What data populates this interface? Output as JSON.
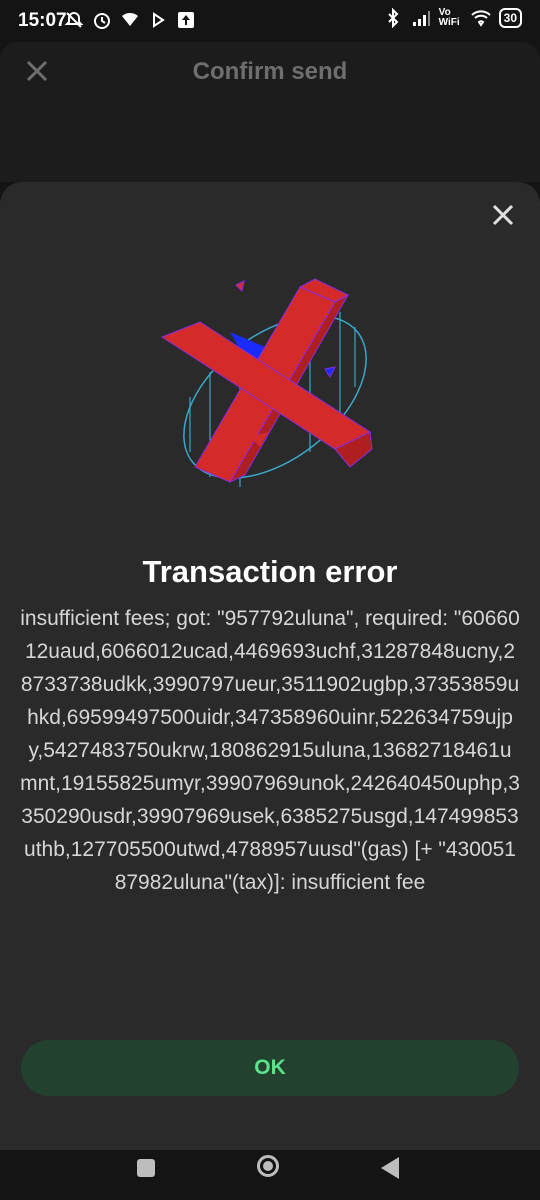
{
  "status_bar": {
    "time": "15:07",
    "network_label": "Vo WiFi",
    "battery": "30",
    "icons": [
      "mute-icon",
      "alarm-icon",
      "data-icon",
      "play-icon",
      "upload-icon",
      "bluetooth-icon",
      "signal-icon",
      "volte-wifi-icon",
      "wifi-icon",
      "battery-icon"
    ]
  },
  "header": {
    "title": "Confirm send"
  },
  "dialog": {
    "title": "Transaction error",
    "message": "insufficient fees; got: \"957792uluna\", required: \"6066012uaud,6066012ucad,4469693uchf,31287848ucny,28733738udkk,3990797ueur,3511902ugbp,37353859uhkd,69599497500uidr,347358960uinr,522634759ujpy,5427483750ukrw,180862915uluna,13682718461umnt,19155825umyr,39907969unok,242640450uphp,3350290usdr,39907969usek,6385275usgd,147499853uthb,127705500utwd,4788957uusd\"(gas) [+ \"43005187982uluna\"(tax)]: insufficient fee",
    "ok_label": "OK"
  },
  "colors": {
    "ok_text": "#5be28a",
    "ok_bg": "#22412f",
    "illustration_red": "#d42a2a",
    "illustration_blue": "#1a2bff"
  }
}
